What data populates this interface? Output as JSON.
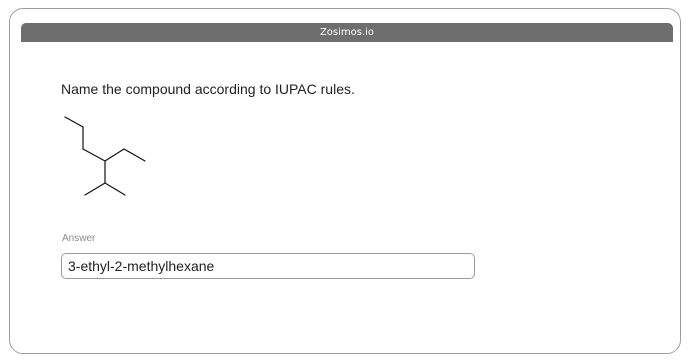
{
  "window": {
    "title": "Zosimos.io"
  },
  "question": {
    "prompt": "Name the compound according to IUPAC rules."
  },
  "answer": {
    "label": "Answer",
    "value": "3-ethyl-2-methylhexane"
  }
}
